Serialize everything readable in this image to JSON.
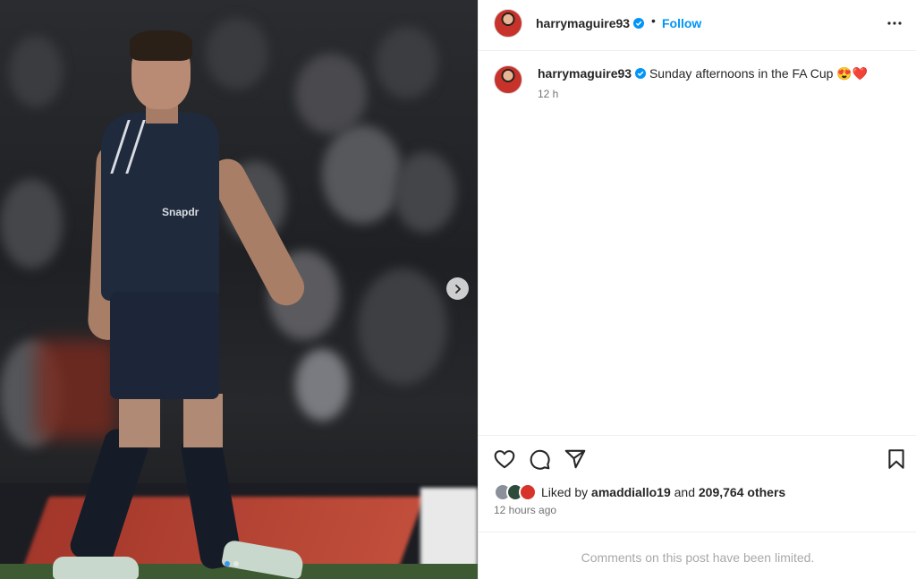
{
  "post": {
    "username": "harrymaguire93",
    "follow_label": "Follow",
    "separator": "•",
    "caption": "Sunday afternoons in the FA Cup 😍❤️",
    "caption_time": "12 h",
    "liked_by_prefix": "Liked by",
    "liked_by_user": "amaddiallo19",
    "liked_by_and": "and",
    "likes_count": "209,764 others",
    "posted_ago": "12 hours ago",
    "comments_notice": "Comments on this post have been limited.",
    "media_sponsor": "Snapdr",
    "carousel_total": 2,
    "carousel_index": 1
  },
  "colors": {
    "accent": "#0095f6",
    "verified": "#0095f6",
    "muted": "#737373",
    "active_dot": "#3897f0"
  },
  "icons": {
    "more": "more-horizontal-icon",
    "like": "heart-icon",
    "comment": "comment-icon",
    "share": "paper-plane-icon",
    "save": "bookmark-icon",
    "next": "chevron-right-icon",
    "verified": "verified-badge-icon"
  }
}
